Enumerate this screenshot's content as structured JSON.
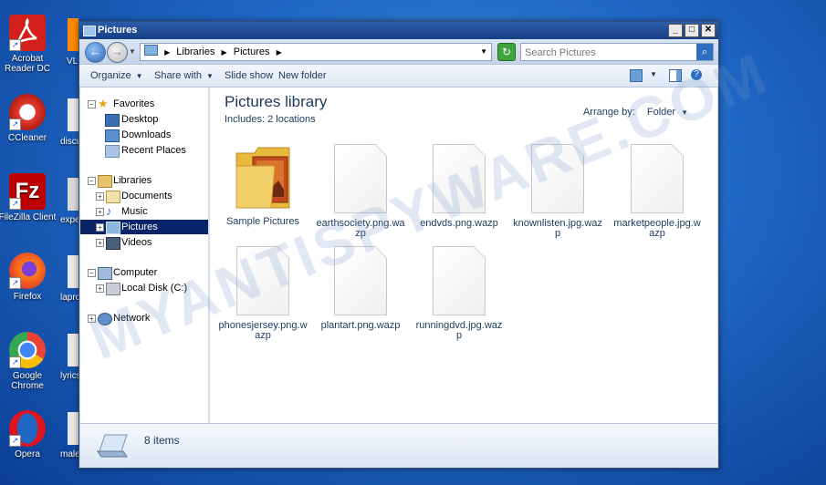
{
  "desktop": {
    "icons": [
      {
        "label": "Acrobat Reader DC",
        "icon": "acrobat-icon"
      },
      {
        "label": "CCleaner",
        "icon": "ccleaner-icon"
      },
      {
        "label": "FileZilla Client",
        "icon": "filezilla-icon"
      },
      {
        "label": "Firefox",
        "icon": "firefox-icon"
      },
      {
        "label": "Google Chrome",
        "icon": "chrome-icon"
      },
      {
        "label": "Opera",
        "icon": "opera-icon"
      }
    ],
    "partial_labels": [
      "VL",
      "discu",
      "expe",
      "lapro",
      "lyrics",
      "male"
    ]
  },
  "window": {
    "title": "Pictures",
    "controls": [
      "_",
      "□",
      "✕"
    ],
    "address": {
      "crumbs": [
        "Libraries",
        "Pictures"
      ]
    },
    "search": {
      "placeholder": "Search Pictures"
    },
    "toolbar": {
      "organize": "Organize",
      "share_with": "Share with",
      "slide_show": "Slide show",
      "new_folder": "New folder"
    },
    "nav": {
      "favorites": "Favorites",
      "desktop": "Desktop",
      "downloads": "Downloads",
      "recent_places": "Recent Places",
      "libraries": "Libraries",
      "documents": "Documents",
      "music": "Music",
      "pictures": "Pictures",
      "videos": "Videos",
      "computer": "Computer",
      "local_disk": "Local Disk (C:)",
      "network": "Network"
    },
    "library": {
      "title": "Pictures library",
      "includes": "Includes:  2 locations",
      "arrange_label": "Arrange by:",
      "arrange_value": "Folder"
    },
    "files": [
      {
        "name": "Sample Pictures",
        "type": "folder"
      },
      {
        "name": "earthsociety.png.wazp",
        "type": "file"
      },
      {
        "name": "endvds.png.wazp",
        "type": "file"
      },
      {
        "name": "knownlisten.jpg.wazp",
        "type": "file"
      },
      {
        "name": "marketpeople.jpg.wazp",
        "type": "file"
      },
      {
        "name": "phonesjersey.png.wazp",
        "type": "file"
      },
      {
        "name": "plantart.png.wazp",
        "type": "file"
      },
      {
        "name": "runningdvd.jpg.wazp",
        "type": "file"
      }
    ],
    "status": {
      "count": "8 items"
    }
  },
  "watermark": {
    "text": "MYANTISPYWARE.COM"
  },
  "colors": {
    "selection": "#0a246a",
    "desktop_blue": "#1f67c4"
  }
}
